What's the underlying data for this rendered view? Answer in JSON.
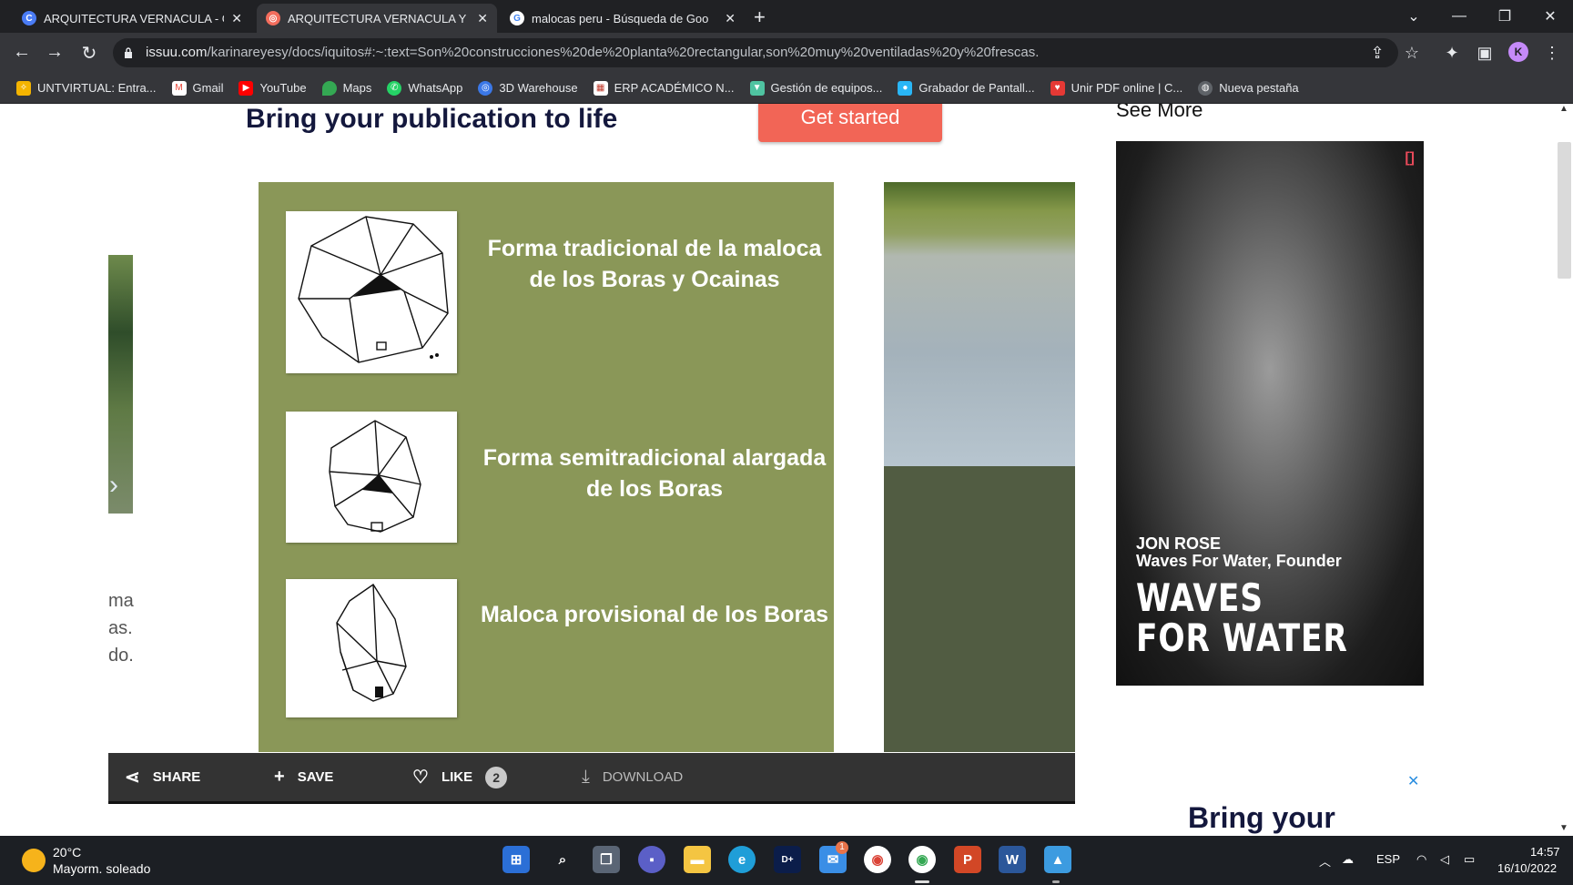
{
  "browser": {
    "tabs": [
      {
        "title": "ARQUITECTURA VERNACULA - G",
        "favicon": "canva-icon",
        "active": false
      },
      {
        "title": "ARQUITECTURA VERNACULA Y S",
        "favicon": "issuu-icon",
        "active": true
      },
      {
        "title": "malocas peru - Búsqueda de Goo",
        "favicon": "google-icon",
        "active": false
      }
    ],
    "url_host": "issuu.com",
    "url_rest": "/karinareyesy/docs/iquitos#:~:text=Son%20construcciones%20de%20planta%20rectangular,son%20muy%20ventiladas%20y%20frescas.",
    "profile_initial": "K",
    "bookmarks": [
      {
        "label": "UNTVIRTUAL: Entra...",
        "icon": "untvirtual-icon",
        "color": "#f4b400"
      },
      {
        "label": "Gmail",
        "icon": "gmail-icon",
        "color": "#ea4335"
      },
      {
        "label": "YouTube",
        "icon": "youtube-icon",
        "color": "#ff0000"
      },
      {
        "label": "Maps",
        "icon": "maps-icon",
        "color": "#34a853"
      },
      {
        "label": "WhatsApp",
        "icon": "whatsapp-icon",
        "color": "#25d366"
      },
      {
        "label": "3D Warehouse",
        "icon": "warehouse-icon",
        "color": "#3b78e7"
      },
      {
        "label": "ERP ACADÉMICO N...",
        "icon": "erp-icon",
        "color": "#c0392b"
      },
      {
        "label": "Gestión de equipos...",
        "icon": "teams-icon",
        "color": "#4fc3a1"
      },
      {
        "label": "Grabador de Pantall...",
        "icon": "recorder-icon",
        "color": "#29b6f6"
      },
      {
        "label": "Unir PDF online | C...",
        "icon": "pdf-icon",
        "color": "#e53935"
      },
      {
        "label": "Nueva pestaña",
        "icon": "globe-icon",
        "color": "#5f6368"
      }
    ]
  },
  "page": {
    "promo_title": "Bring your publication to life",
    "cta_label": "Get started",
    "left_text_lines": [
      "ma",
      "as.",
      "do."
    ],
    "slide_items": [
      {
        "caption": "Forma tradicional de la maloca de los Boras y Ocainas"
      },
      {
        "caption": "Forma semitradicional alargada de los Boras"
      },
      {
        "caption": "Maloca provisional de los Boras"
      }
    ],
    "share_bar": {
      "share": "SHARE",
      "save": "SAVE",
      "like": "LIKE",
      "like_count": "2",
      "download": "DOWNLOAD"
    },
    "sidebar": {
      "see_more": "See More",
      "ad_marker": "[]",
      "ad_name": "JON ROSE",
      "ad_role": "Waves For Water, Founder",
      "ad_headline_1": "WAVES",
      "ad_headline_2": "FOR WATER",
      "ad_close": "✕",
      "promo_bottom": "Bring your"
    }
  },
  "taskbar": {
    "temperature": "20°C",
    "weather": "Mayorm. soleado",
    "language": "ESP",
    "time": "14:57",
    "date": "16/10/2022",
    "mail_badge": "1"
  },
  "colors": {
    "slide_green": "#8a9758",
    "cta": "#f26556",
    "promo_navy": "#14183d"
  }
}
